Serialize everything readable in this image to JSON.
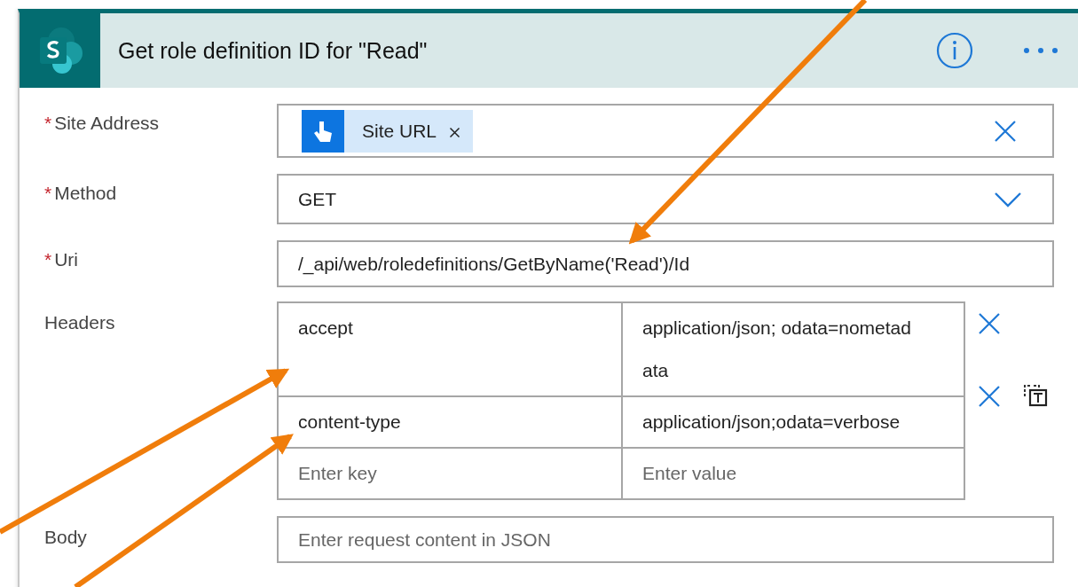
{
  "card": {
    "title": "Get role definition ID for \"Read\""
  },
  "required_marker": "*",
  "fields": [
    {
      "kind": "token",
      "label": "Site Address",
      "required": true,
      "token": "Site URL"
    },
    {
      "kind": "dropdown",
      "label": "Method",
      "required": true,
      "value": "GET"
    },
    {
      "kind": "text",
      "label": "Uri",
      "required": true,
      "value": "/_api/web/roledefinitions/GetByName('Read')/Id"
    },
    {
      "kind": "table",
      "label": "Headers",
      "required": false,
      "rows": [
        {
          "key": "accept",
          "value": "application/json; odata=nometadata"
        },
        {
          "key": "content-type",
          "value": "application/json;odata=verbose"
        }
      ],
      "key_placeholder": "Enter key",
      "value_placeholder": "Enter value"
    },
    {
      "kind": "text",
      "label": "Body",
      "required": false,
      "placeholder": "Enter request content in JSON"
    }
  ]
}
